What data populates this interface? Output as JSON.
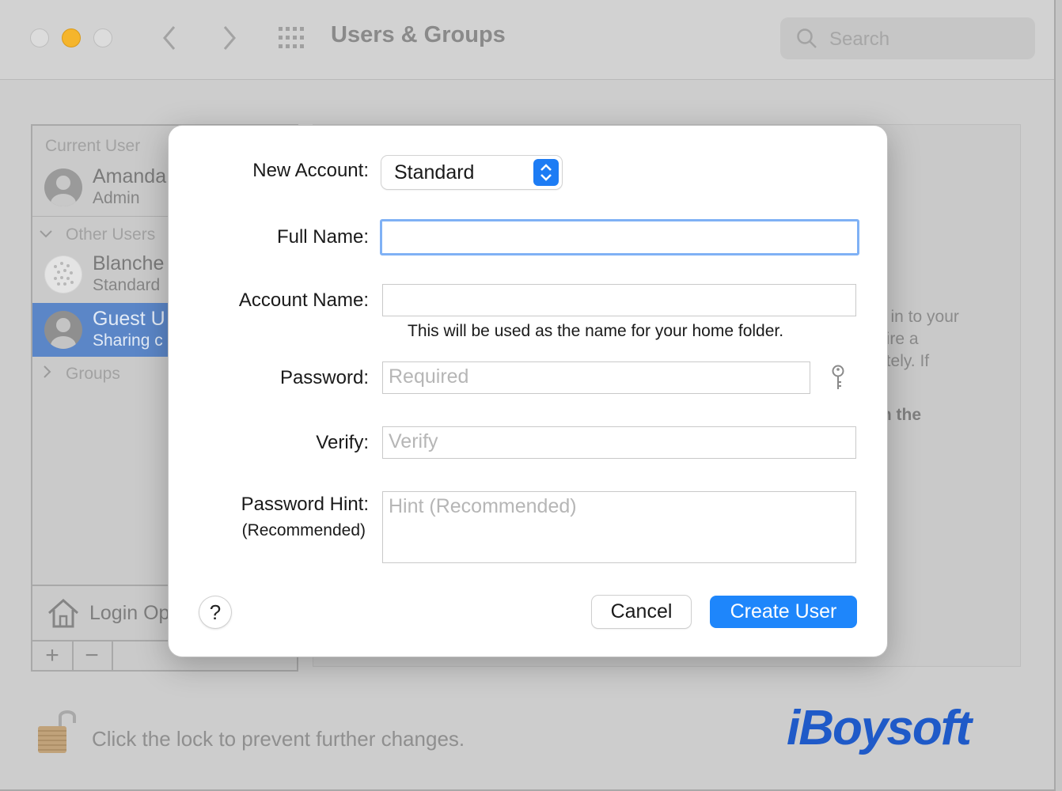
{
  "window": {
    "title": "Users & Groups",
    "search_placeholder": "Search"
  },
  "sidebar": {
    "current_user_header": "Current User",
    "current_user": {
      "name": "Amanda",
      "role": "Admin"
    },
    "other_users_header": "Other Users",
    "other_users": [
      {
        "name": "Blanche",
        "role": "Standard"
      },
      {
        "name": "Guest U",
        "role": "Sharing c"
      }
    ],
    "groups_label": "Groups",
    "login_options_label": "Login Op",
    "add_symbol": "+",
    "remove_symbol": "−"
  },
  "background_panel": {
    "line1": "g in to your",
    "line2": "uire a",
    "line3": "otely. If",
    "line4": ".",
    "line5": "in the"
  },
  "footer": {
    "lock_text": "Click the lock to prevent further changes.",
    "logo_text": "iBoysoft"
  },
  "dialog": {
    "new_account_label": "New Account:",
    "account_type_value": "Standard",
    "full_name_label": "Full Name:",
    "full_name_value": "",
    "account_name_label": "Account Name:",
    "account_name_value": "",
    "home_folder_note": "This will be used as the name for your home folder.",
    "password_label": "Password:",
    "password_placeholder": "Required",
    "verify_label": "Verify:",
    "verify_placeholder": "Verify",
    "hint_label": "Password Hint:",
    "hint_sublabel": "(Recommended)",
    "hint_placeholder": "Hint (Recommended)",
    "help_label": "?",
    "cancel_label": "Cancel",
    "create_label": "Create User"
  },
  "colors": {
    "accent": "#1e86fb",
    "selection": "#5b86c7",
    "minimize": "#f5b52c"
  }
}
